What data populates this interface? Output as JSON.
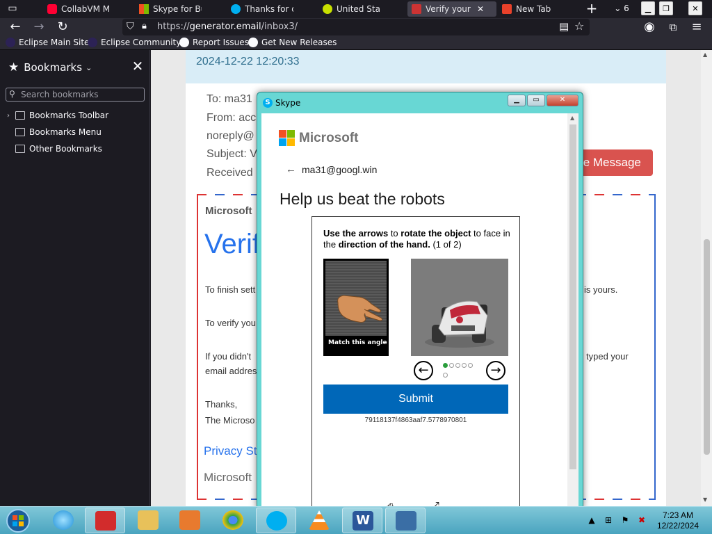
{
  "tabs": [
    {
      "label": "CollabVM Ma",
      "icon": "youtube-icon"
    },
    {
      "label": "Skype for Bus",
      "icon": "microsoft-icon"
    },
    {
      "label": "Thanks for dc",
      "icon": "skype-icon"
    },
    {
      "label": "United Sta",
      "icon": "speaker-icon"
    },
    {
      "label": "Verify your",
      "icon": "mail-icon",
      "active": true
    },
    {
      "label": "New Tab",
      "icon": "firefox-icon"
    }
  ],
  "tab_count": "6",
  "url": {
    "protocol": "https://",
    "host": "generator.email",
    "path": "/inbox3/"
  },
  "bookmarks_bar": [
    "Eclipse Main Site",
    "Eclipse Community",
    "Report Issues",
    "Get New Releases"
  ],
  "sidebar": {
    "title": "Bookmarks",
    "search_placeholder": "Search bookmarks",
    "items": [
      "Bookmarks Toolbar",
      "Bookmarks Menu",
      "Other Bookmarks"
    ]
  },
  "mail": {
    "date": "2024-12-22 12:20:33",
    "to": "To: ma31",
    "from": "From: acc",
    "from2": "noreply@",
    "subject": "Subject: V",
    "received": "Received",
    "delete_label": "te Message",
    "brand": "Microsoft",
    "verify_heading": "Verif",
    "para1": "To finish sett",
    "para1_end": "is yours.",
    "para2": "To verify you",
    "para3": "If you didn't",
    "para3_end": "typed your",
    "para3_line2": "email addres",
    "thanks": "Thanks,",
    "signoff": "The Microso",
    "privacy": "Privacy St",
    "footer_brand": "Microsoft"
  },
  "skype": {
    "window_title": "Skype",
    "ms_brand": "Microsoft",
    "account": "ma31@googl.win",
    "heading": "Help us beat the robots",
    "instr_b1": "Use the arrows",
    "instr_t1": " to ",
    "instr_b2": "rotate the object",
    "instr_t2": " to face in the ",
    "instr_b3": "direction of the hand.",
    "instr_t3": " (1 of 2)",
    "ref_caption": "Match this angle",
    "submit": "Submit",
    "token": "79118137f4863aaf7.5778970801",
    "progress_step": 1,
    "progress_total": 6
  },
  "taskbar": {
    "time": "7:23 AM",
    "date": "12/22/2024",
    "apps": [
      "app-red-icon",
      "ie-icon",
      "app-red-icon",
      "explorer-icon",
      "media-icon",
      "chrome-icon",
      "skype-icon",
      "vlc-icon",
      "word-icon",
      "remote-desktop-icon"
    ]
  },
  "colors": {
    "accent": "#0067b8",
    "skype_frame": "#68d7d4",
    "delete_btn": "#d9534f",
    "date_bar": "#d9edf7"
  }
}
